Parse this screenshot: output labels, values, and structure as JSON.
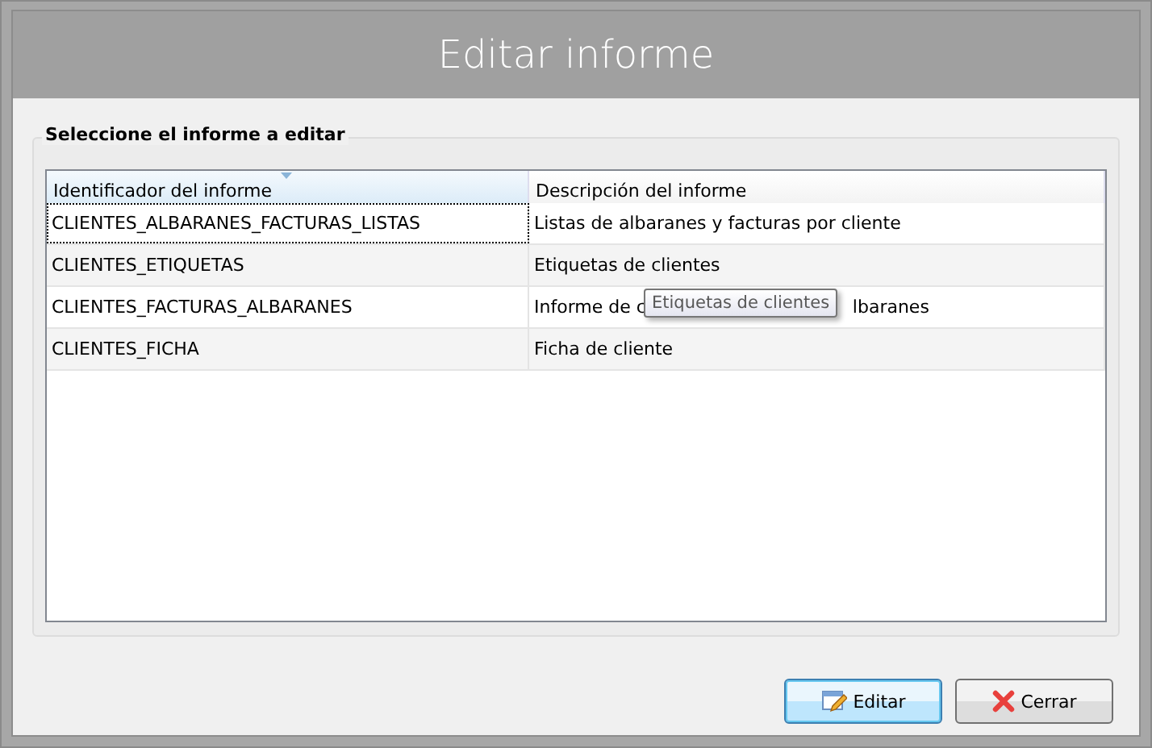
{
  "window": {
    "title": "Editar informe"
  },
  "group": {
    "title": "Seleccione el informe a editar"
  },
  "table": {
    "columns": [
      {
        "label": "Identificador del informe",
        "sorted": true
      },
      {
        "label": "Descripción del informe",
        "sorted": false
      }
    ],
    "rows": [
      {
        "id": "CLIENTES_ALBARANES_FACTURAS_LISTAS",
        "description": [
          "Listas de albaranes y facturas por cliente"
        ],
        "selected": true
      },
      {
        "id": "CLIENTES_ETIQUETAS",
        "description": [
          "Etiquetas de clientes"
        ],
        "selected": false
      },
      {
        "id": "CLIENTES_FACTURAS_ALBARANES",
        "description": [
          "Informe de c",
          "lbaranes"
        ],
        "selected": false
      },
      {
        "id": "CLIENTES_FICHA",
        "description": [
          "Ficha de cliente"
        ],
        "selected": false
      }
    ]
  },
  "tooltip": {
    "text": "Etiquetas de clientes"
  },
  "buttons": [
    {
      "label": "Editar",
      "kind": "edit",
      "default": true
    },
    {
      "label": "Cerrar",
      "kind": "close",
      "default": false
    }
  ]
}
